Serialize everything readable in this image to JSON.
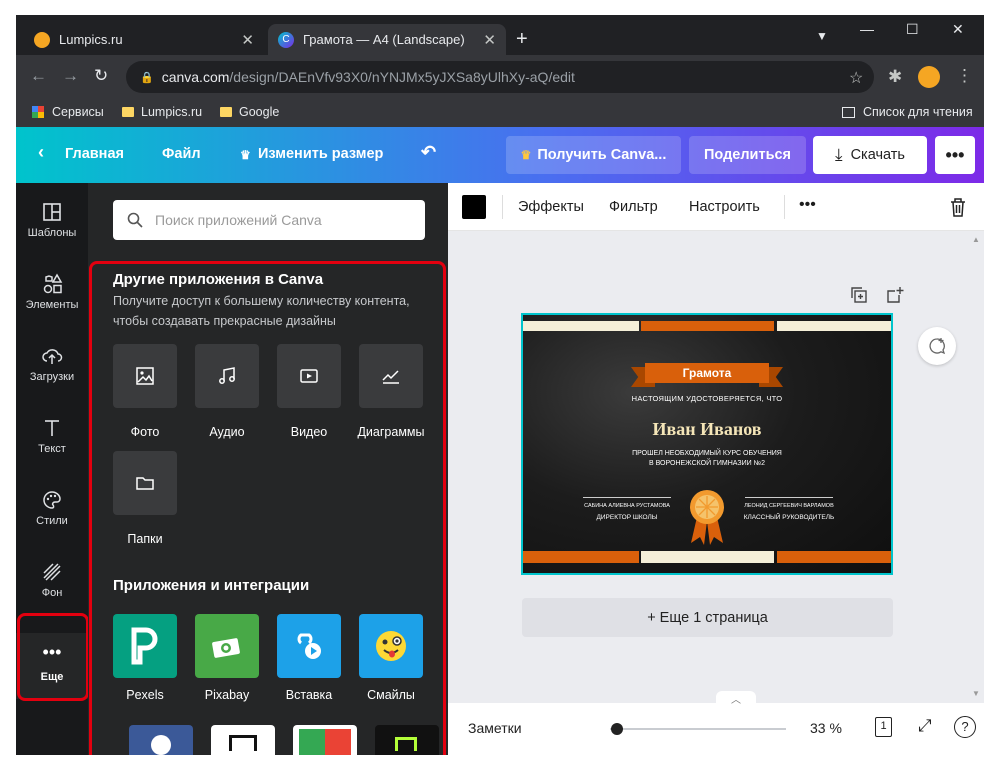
{
  "browser": {
    "tabs": [
      {
        "title": "Lumpics.ru"
      },
      {
        "title": "Грамота — A4 (Landscape)"
      }
    ],
    "url_domain": "canva.com",
    "url_path": "/design/DAEnVfv93X0/nYNJMx5yJXSa8yUlhXy-aQ/edit",
    "bookmarks": [
      "Сервисы",
      "Lumpics.ru",
      "Google"
    ],
    "reading_list": "Список для чтения"
  },
  "canva": {
    "header": {
      "home": "Главная",
      "file": "Файл",
      "resize": "Изменить размер",
      "pro": "Получить Canva...",
      "share": "Поделиться",
      "download": "Скачать"
    },
    "rail": [
      "Шаблоны",
      "Элементы",
      "Загрузки",
      "Текст",
      "Стили",
      "Фон",
      "Еще"
    ],
    "panel": {
      "search_placeholder": "Поиск приложений Canva",
      "other_title": "Другие приложения в Canva",
      "other_sub": "Получите доступ к большему количеству контента, чтобы создавать прекрасные дизайны",
      "apps": [
        "Фото",
        "Аудио",
        "Видео",
        "Диаграммы",
        "Папки"
      ],
      "integrations_title": "Приложения и интеграции",
      "integrations": [
        "Pexels",
        "Pixabay",
        "Вставка",
        "Смайлы"
      ]
    },
    "toolbar": {
      "effects": "Эффекты",
      "filter": "Фильтр",
      "adjust": "Настроить"
    },
    "certificate": {
      "ribbon": "Грамота",
      "line1": "НАСТОЯЩИМ УДОСТОВЕРЯЕТСЯ, ЧТО",
      "name": "Иван Иванов",
      "line2": "ПРОШЕЛ НЕОБХОДИМЫЙ КУРС ОБУЧЕНИЯ",
      "line3": "В ВОРОНЕЖСКОЙ ГИМНАЗИИ №2",
      "sig1_name": "САБИНА АЛИЕВНА РУСТАМОВА",
      "sig1_role": "ДИРЕКТОР ШКОЛЫ",
      "sig2_name": "ЛЕОНИД СЕРГЕЕВИЧ ВАРЛАМОВ",
      "sig2_role": "КЛАССНЫЙ РУКОВОДИТЕЛЬ"
    },
    "more_pages": "+ Еще 1 страница",
    "bottom": {
      "notes": "Заметки",
      "zoom": "33 %",
      "page": "1",
      "help": "?",
      "zoom_fraction": 0.04
    }
  }
}
